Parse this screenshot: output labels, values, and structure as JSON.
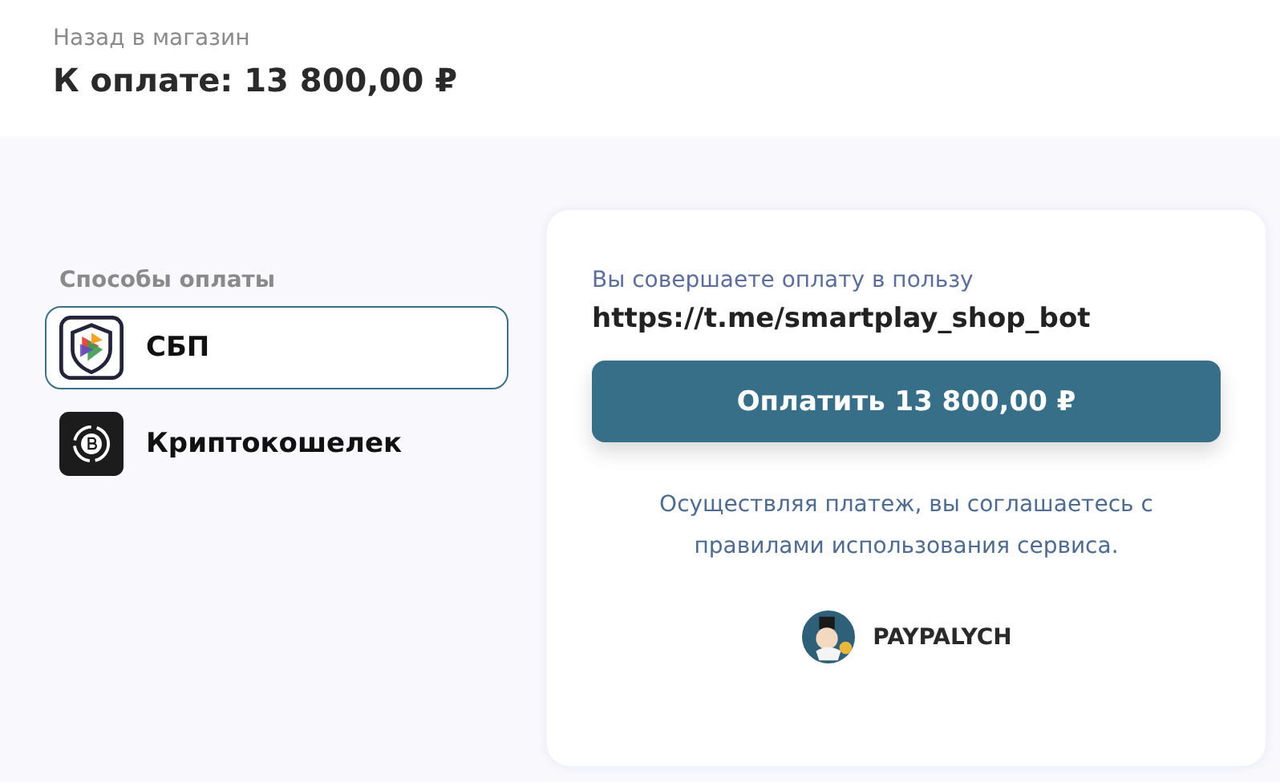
{
  "header": {
    "back_link": "Назад в магазин",
    "amount_title": "К оплате: 13 800,00 ₽"
  },
  "payment_methods": {
    "title": "Способы оплаты",
    "items": [
      {
        "kind": "sbp",
        "label": "СБП",
        "selected": true
      },
      {
        "kind": "crypto",
        "label": "Криптокошелек",
        "selected": false
      }
    ]
  },
  "payment_card": {
    "recipient_label": "Вы совершаете оплату в пользу",
    "recipient": "https://t.me/smartplay_shop_bot",
    "pay_button": "Оплатить 13 800,00 ₽",
    "terms": "Осуществляя платеж, вы соглашаетесь с правилами использования сервиса.",
    "provider": "PAYPALYCH"
  }
}
